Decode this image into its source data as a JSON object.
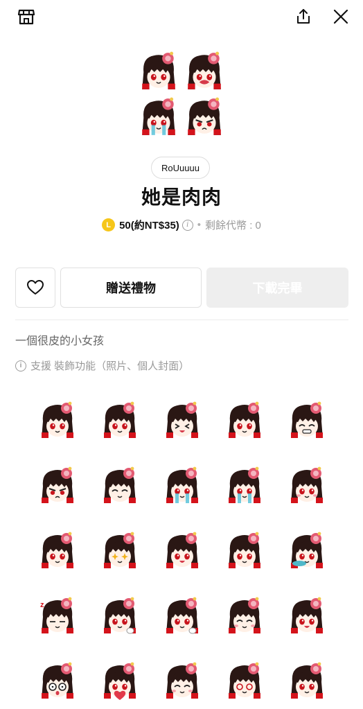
{
  "topbar": {
    "icons": [
      "shop-icon",
      "share-icon",
      "close-icon"
    ]
  },
  "package": {
    "author": "RoUuuuu",
    "title": "她是肉肉",
    "coin_symbol": "L",
    "price": "50(約NT$35)",
    "info_symbol": "i",
    "remaining": "剩餘代幣 : 0"
  },
  "actions": {
    "gift_label": "贈送禮物",
    "download_label": "下載完畢"
  },
  "description": "一個很皮的小女孩",
  "support": {
    "info_symbol": "i",
    "text": "支援 裝飾功能（照片、個人封面）"
  },
  "colors": {
    "coin": "#f6c619",
    "hair": "#2a1714",
    "hair_tips": "#d4131b",
    "skin": "#fff0e6",
    "bow": "#e35a72",
    "disabled_button": "#eeeeee"
  },
  "preview_emoji": [
    "neutral",
    "shout",
    "crying",
    "angry"
  ],
  "emoji": [
    "neutral",
    "neutral",
    "laughing",
    "thinking",
    "grin",
    "angry",
    "squint",
    "crying",
    "teary",
    "blush",
    "spit",
    "sparkle",
    "tongue",
    "neutral",
    "dragon",
    "sleepy",
    "waving",
    "thumbs",
    "content",
    "drool",
    "shocked",
    "heart",
    "smile",
    "dizzy",
    "neutral"
  ]
}
